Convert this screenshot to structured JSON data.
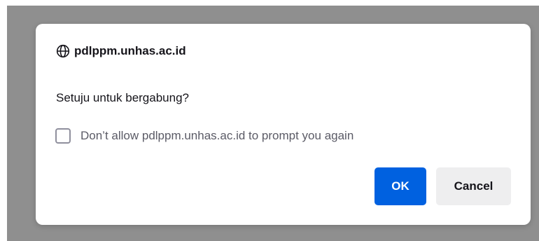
{
  "dialog": {
    "origin": "pdlppm.unhas.ac.id",
    "origin_icon": "globe-icon",
    "message": "Setuju untuk bergabung?",
    "checkbox": {
      "label": "Don’t allow pdlppm.unhas.ac.id to prompt you again",
      "checked": false
    },
    "buttons": {
      "ok_label": "OK",
      "cancel_label": "Cancel"
    }
  },
  "colors": {
    "overlay": "#8f8f8f",
    "dialog_bg": "#ffffff",
    "primary": "#0061e0",
    "secondary": "#eeeeef",
    "text": "#15141a",
    "muted_text": "#5b5b66"
  }
}
